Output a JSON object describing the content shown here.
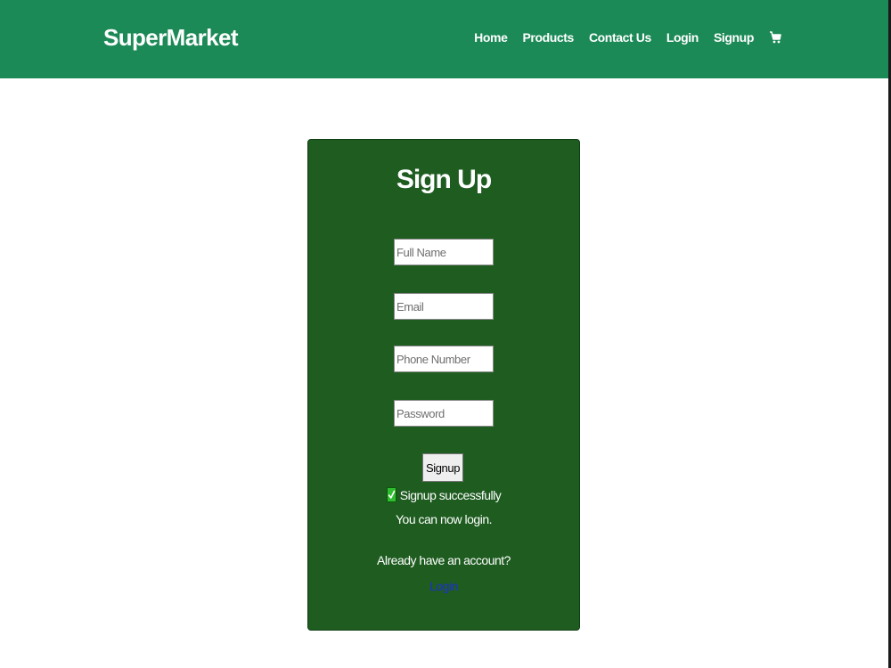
{
  "header": {
    "brand": "SuperMarket",
    "nav": [
      {
        "label": "Home"
      },
      {
        "label": "Products"
      },
      {
        "label": "Contact Us"
      },
      {
        "label": "Login"
      },
      {
        "label": "Signup"
      }
    ],
    "cart_icon": "shopping-cart-icon"
  },
  "signup": {
    "title": "Sign Up",
    "fields": {
      "full_name": {
        "placeholder": "Full Name",
        "value": ""
      },
      "email": {
        "placeholder": "Email",
        "value": ""
      },
      "phone": {
        "placeholder": "Phone Number",
        "value": ""
      },
      "password": {
        "placeholder": "Password",
        "value": ""
      }
    },
    "button_label": "Signup",
    "success_icon": "check-mark-icon",
    "success_message": "Signup successfully",
    "success_sub": "You can now login.",
    "account_prompt": "Already have an account?",
    "login_link": "Login"
  },
  "colors": {
    "navbar": "#1c8a57",
    "card": "#1e5c20",
    "link": "#1f2fd0",
    "check": "#2fbd2f"
  }
}
